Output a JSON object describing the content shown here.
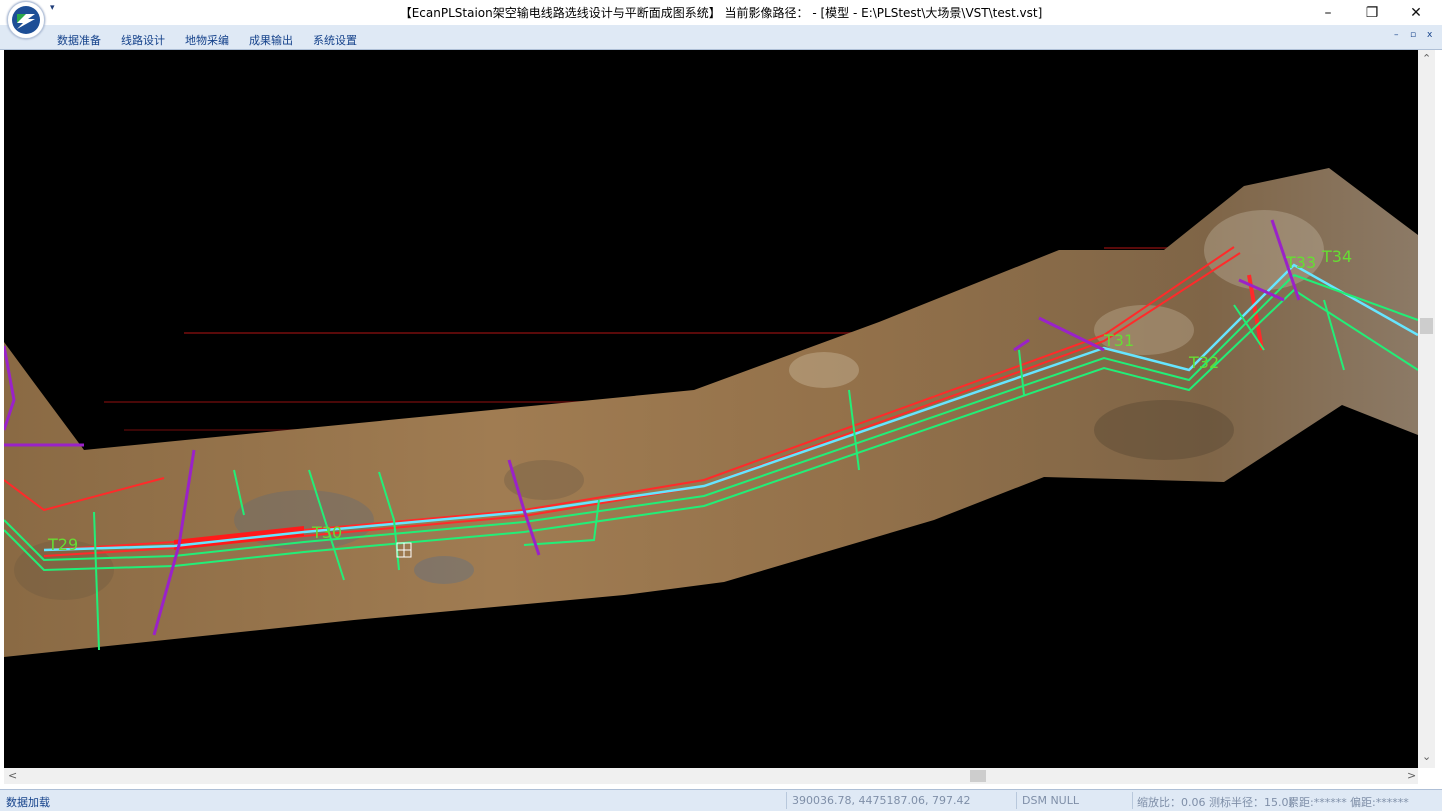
{
  "window": {
    "title": "【EcanPLStaion架空输电线路选线设计与平断面成图系统】 当前影像路径： - [模型 - E:\\PLStest\\大场景\\VST\\test.vst]",
    "minimize_glyph": "–",
    "restore_glyph": "❐",
    "close_glyph": "✕",
    "quick_access_glyph": "▾"
  },
  "menu": {
    "items": [
      {
        "label": "数据准备"
      },
      {
        "label": "线路设计"
      },
      {
        "label": "地物采编"
      },
      {
        "label": "成果输出"
      },
      {
        "label": "系统设置"
      }
    ],
    "mdi_minimize": "–",
    "mdi_restore": "▫",
    "mdi_close": "x"
  },
  "map": {
    "tower_labels": [
      "T29",
      "T30",
      "T31",
      "T32",
      "T33",
      "T34"
    ]
  },
  "scroll": {
    "up": "⌃",
    "down": "⌄",
    "left": "<",
    "right": ">"
  },
  "status": {
    "message": "数据加载",
    "coords": "390036.78, 4475187.06,  797.42",
    "dsm": "DSM NULL",
    "scale": "缩放比：0.06",
    "radius": "测标半径：15.0(",
    "cumulative": "累距:******",
    "offset": "偏距:******"
  },
  "colors": {
    "menu_bg": "#dfe9f5",
    "menu_text": "#15428b",
    "line_red": "#ff2a2a",
    "line_cyan": "#66e6ff",
    "line_green": "#22ee77",
    "line_purple": "#9a22c8",
    "label_green": "#66dd33"
  }
}
